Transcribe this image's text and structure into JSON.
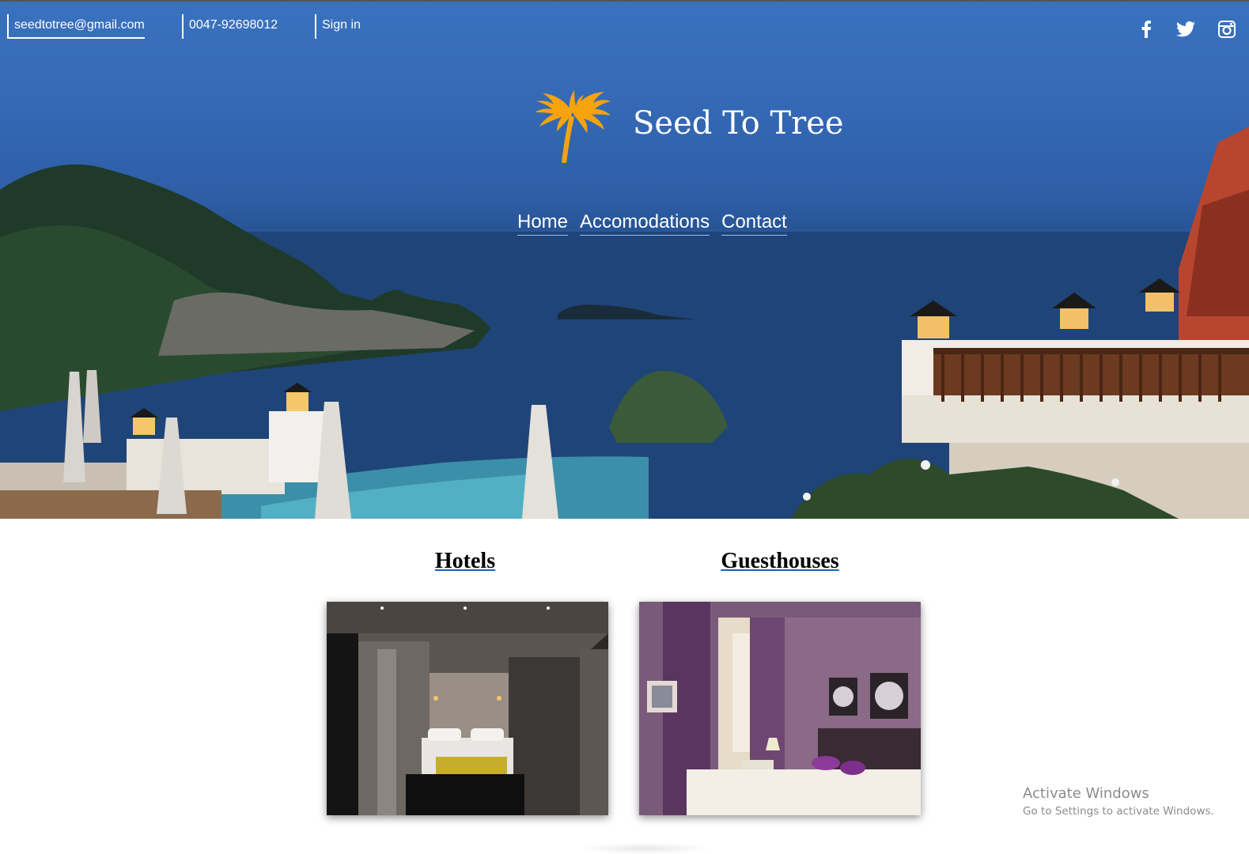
{
  "header": {
    "email": "seedtotree@gmail.com",
    "phone": "0047-92698012",
    "signin": "Sign in"
  },
  "social": [
    {
      "icon": "facebook-icon"
    },
    {
      "icon": "twitter-icon"
    },
    {
      "icon": "instagram-icon"
    }
  ],
  "brand": {
    "title": "Seed To Tree",
    "logo_icon": "palm-tree-icon",
    "logo_color": "#f5a30f"
  },
  "nav": {
    "home": "Home",
    "accomodations": "Accomodations",
    "contact": "Contact"
  },
  "sections": {
    "hotels": {
      "heading": "Hotels"
    },
    "guesthouses": {
      "heading": "Guesthouses"
    }
  },
  "watermark": {
    "title": "Activate Windows",
    "subtitle": "Go to Settings to activate Windows."
  },
  "colors": {
    "link_underline": "#1b5fcc",
    "hero_sky": "#3a72bf"
  }
}
